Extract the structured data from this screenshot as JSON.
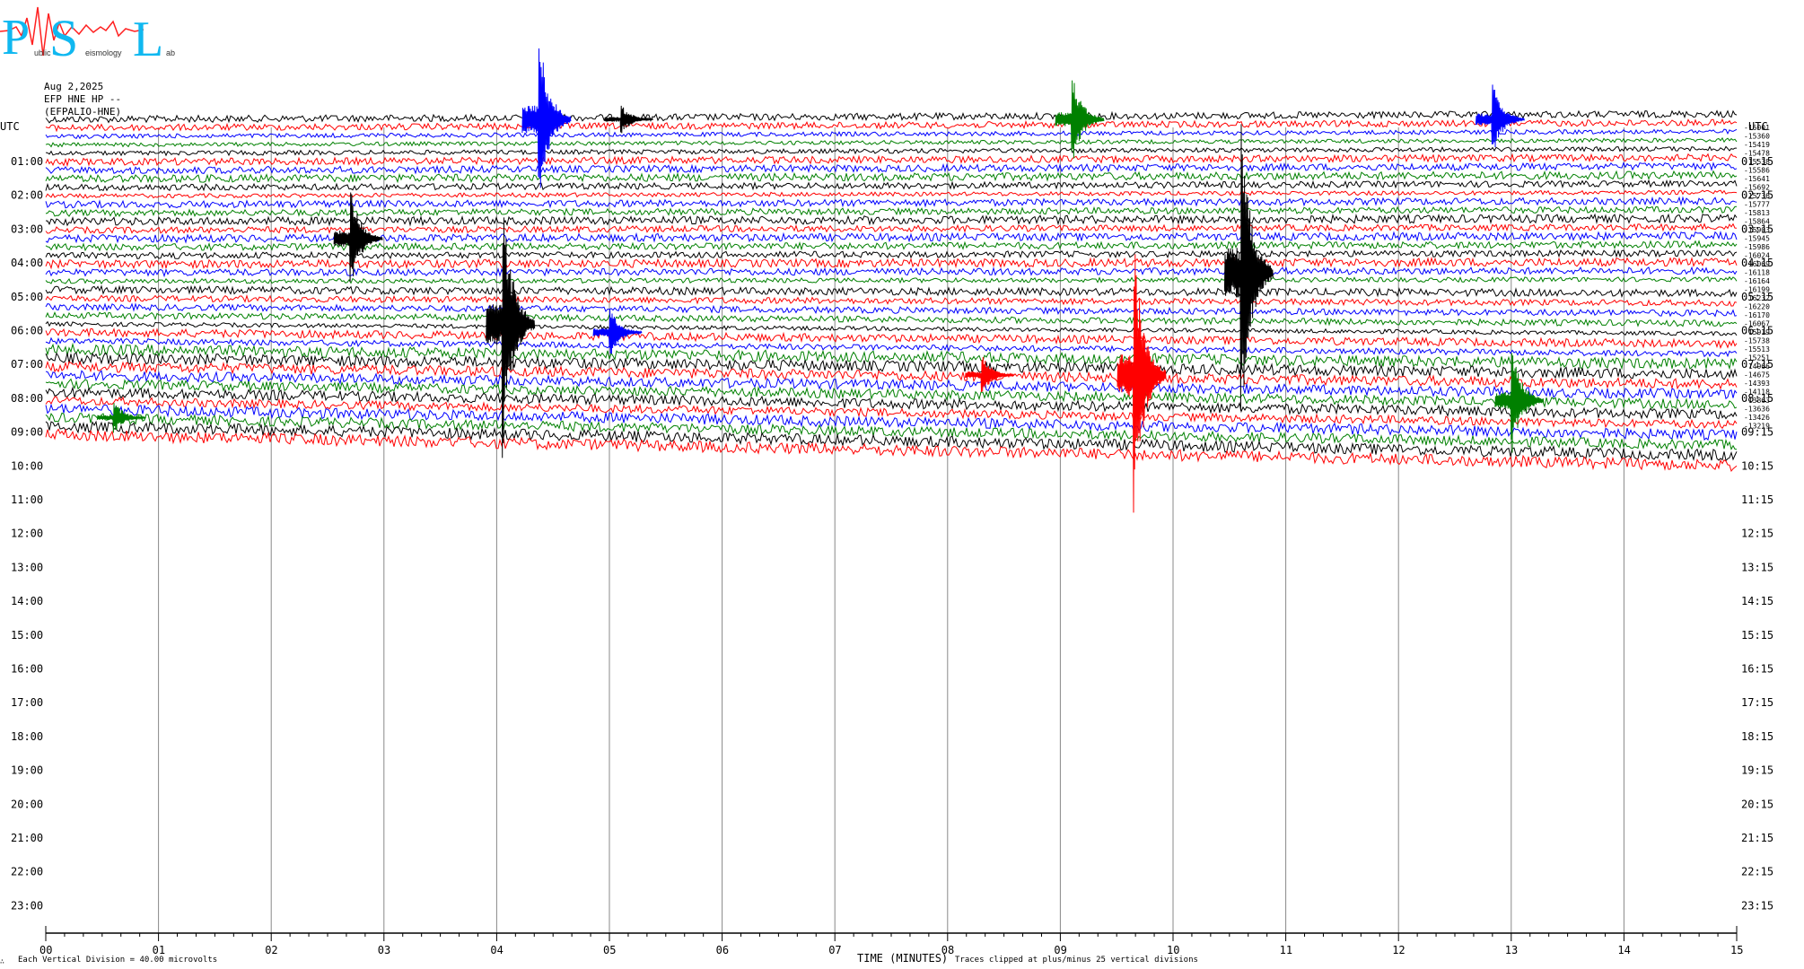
{
  "logo": {
    "letters": [
      "P",
      "S",
      "L"
    ],
    "subtext": [
      "ublic",
      "eismology",
      "ab"
    ]
  },
  "header": {
    "date": "Aug 2,2025",
    "station": "EFP HNE HP --",
    "channel": "(EFPALIO-HNE)"
  },
  "axis": {
    "left_title": "UTC",
    "right_title": "UTC",
    "left_times": [
      "01:00",
      "02:00",
      "03:00",
      "04:00",
      "05:00",
      "06:00",
      "07:00",
      "08:00",
      "09:00",
      "10:00",
      "11:00",
      "12:00",
      "13:00",
      "14:00",
      "15:00",
      "16:00",
      "17:00",
      "18:00",
      "19:00",
      "20:00",
      "21:00",
      "22:00",
      "23:00"
    ],
    "right_times": [
      "01:15",
      "02:15",
      "03:15",
      "04:15",
      "05:15",
      "06:15",
      "07:15",
      "08:15",
      "09:15",
      "10:15",
      "11:15",
      "12:15",
      "13:15",
      "14:15",
      "15:15",
      "16:15",
      "17:15",
      "18:15",
      "19:15",
      "20:15",
      "21:15",
      "22:15",
      "23:15"
    ],
    "x_ticks": [
      "00",
      "01",
      "02",
      "03",
      "04",
      "05",
      "06",
      "07",
      "08",
      "09",
      "10",
      "11",
      "12",
      "13",
      "14",
      "15"
    ],
    "x_title": "TIME (MINUTES)"
  },
  "footer": {
    "corner_mark": "∴",
    "scale_note": "Each Vertical Division =   40.00 microvolts",
    "clip_note": "Traces clipped at plus/minus 25 vertical divisions"
  },
  "chart_data": {
    "type": "line",
    "title": "",
    "xlabel": "TIME (MINUTES)",
    "ylabel": "UTC",
    "xlim": [
      0,
      15
    ],
    "trace_colors": [
      "#000000",
      "#ff0000",
      "#0000ff",
      "#008000"
    ],
    "trace_count": 38,
    "trace_offsets": [
      "-16001",
      "-15360",
      "-15419",
      "-15478",
      "-15538",
      "-15586",
      "-15641",
      "-15692",
      "-15736",
      "-15777",
      "-15813",
      "-15864",
      "-15903",
      "-15945",
      "-15986",
      "-16024",
      "-16069",
      "-16118",
      "-16164",
      "-16199",
      "-16232",
      "-16220",
      "-16170",
      "-16067",
      "-15919",
      "-15738",
      "-15513",
      "-15251",
      "-14966",
      "-14675",
      "-14393",
      "-14118",
      "-13863",
      "-13636",
      "-13426",
      "-13219"
    ],
    "events": [
      {
        "trace": 0,
        "minute": 4.37,
        "amplitude": 105,
        "color": "#0000ff"
      },
      {
        "trace": 0,
        "minute": 5.1,
        "amplitude": 18,
        "color": "#000000"
      },
      {
        "trace": 0,
        "minute": 9.1,
        "amplitude": 55,
        "color": "#008000"
      },
      {
        "trace": 0,
        "minute": 12.83,
        "amplitude": 45,
        "color": "#0000ff"
      },
      {
        "trace": 14,
        "minute": 2.7,
        "amplitude": 60,
        "color": "#000000"
      },
      {
        "trace": 18,
        "minute": 10.6,
        "amplitude": 185,
        "color": "#000000"
      },
      {
        "trace": 24,
        "minute": 4.05,
        "amplitude": 160,
        "color": "#000000"
      },
      {
        "trace": 25,
        "minute": 5.0,
        "amplitude": 30,
        "color": "#0000ff"
      },
      {
        "trace": 30,
        "minute": 9.65,
        "amplitude": 160,
        "color": "#ff0000"
      },
      {
        "trace": 30,
        "minute": 8.3,
        "amplitude": 25,
        "color": "#ff0000"
      },
      {
        "trace": 33,
        "minute": 13.0,
        "amplitude": 65,
        "color": "#008000"
      },
      {
        "trace": 35,
        "minute": 0.6,
        "amplitude": 20,
        "color": "#008000"
      }
    ]
  }
}
